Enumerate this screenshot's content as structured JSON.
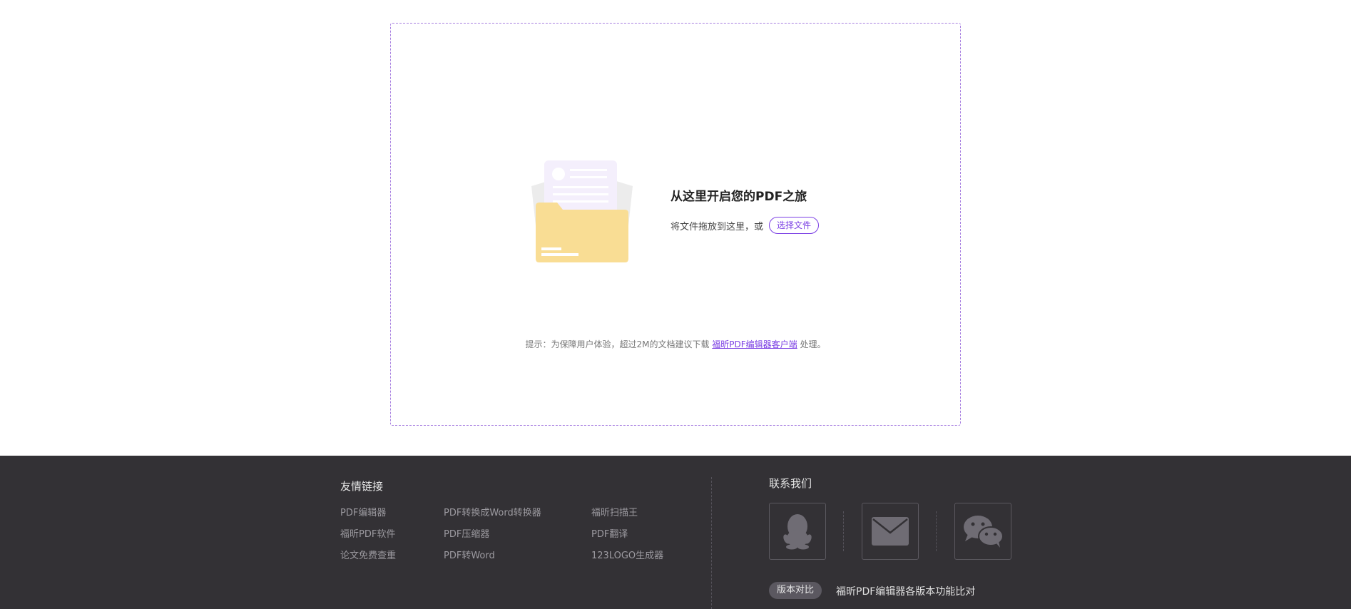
{
  "upload": {
    "title": "从这里开启您的PDF之旅",
    "drag_text": "将文件拖放到这里，或",
    "choose_button": "选择文件",
    "tip_prefix": "提示：为保障用户体验，超过2M的文档建议下载 ",
    "tip_link": "福昕PDF编辑器客户端",
    "tip_suffix": " 处理。"
  },
  "footer": {
    "links_title": "友情链接",
    "links": [
      "PDF编辑器",
      "PDF转换成Word转换器",
      "福昕扫描王",
      "福昕PDF软件",
      "PDF压缩器",
      "PDF翻译",
      "论文免费查重",
      "PDF转Word",
      "123LOGO生成器"
    ],
    "contact_title": "联系我们",
    "contact_icons": [
      "qq-icon",
      "mail-icon",
      "wechat-icon"
    ],
    "version_badge": "版本对比",
    "version_desc": "福昕PDF编辑器各版本功能比对"
  },
  "colors": {
    "accent": "#7b3fe4",
    "footer_bg": "#333135",
    "folder": "#f9dd94"
  }
}
